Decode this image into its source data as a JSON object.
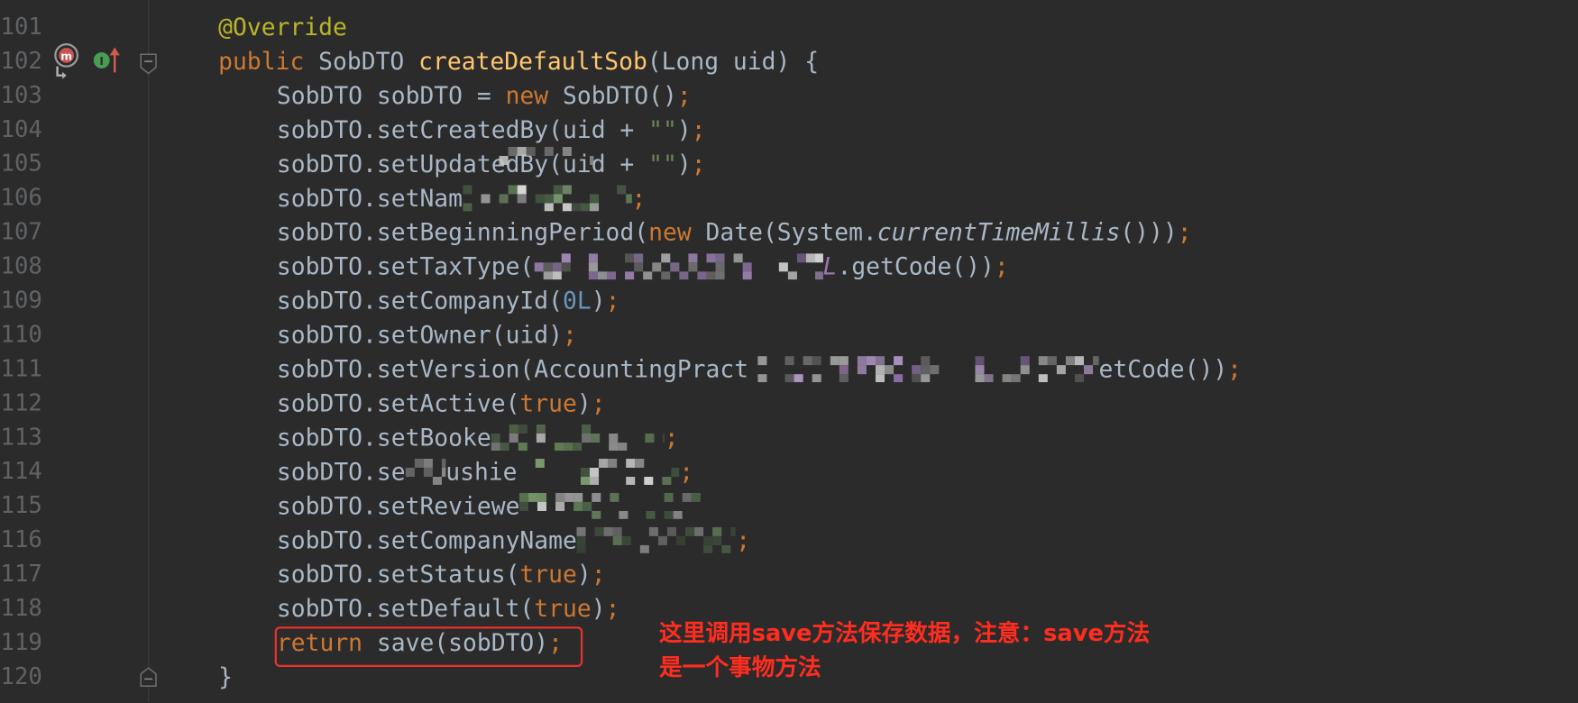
{
  "editor": {
    "theme": "darcula",
    "background": "#2b2b2b",
    "line_number_color": "#606366"
  },
  "syntax_colors": {
    "pl": "#a9b7c6",
    "kw": "#cc7832",
    "ann": "#bbb529",
    "fn": "#ffc66d",
    "str": "#6a8759",
    "num": "#6897bb",
    "it": "#a9b7c6",
    "pu": "#9876aa",
    "semi": "#cc7832"
  },
  "gutter": {
    "line": "102",
    "icons": [
      "overrides-method-icon",
      "implemented-method-icon"
    ],
    "fold_markers": [
      "102",
      "120"
    ]
  },
  "lines": [
    {
      "num": "101",
      "indent": 1,
      "segs": [
        {
          "t": "ann",
          "v": "@Override"
        }
      ]
    },
    {
      "num": "102",
      "indent": 1,
      "segs": [
        {
          "t": "kw",
          "v": "public"
        },
        {
          "t": "pl",
          "v": " SobDTO "
        },
        {
          "t": "fn",
          "v": "createDefaultSob"
        },
        {
          "t": "pl",
          "v": "(Long uid) {"
        }
      ]
    },
    {
      "num": "103",
      "indent": 2,
      "segs": [
        {
          "t": "pl",
          "v": "SobDTO sobDTO = "
        },
        {
          "t": "kw",
          "v": "new"
        },
        {
          "t": "pl",
          "v": " SobDTO()"
        },
        {
          "t": "semi",
          "v": ";"
        }
      ]
    },
    {
      "num": "104",
      "indent": 2,
      "segs": [
        {
          "t": "pl",
          "v": "sobDTO.setCreatedBy(uid + "
        },
        {
          "t": "str",
          "v": "\"\""
        },
        {
          "t": "pl",
          "v": ")"
        },
        {
          "t": "semi",
          "v": ";"
        }
      ]
    },
    {
      "num": "105",
      "indent": 2,
      "segs": [
        {
          "t": "pl",
          "v": "sobDTO.setUpdatedBy(uid + "
        },
        {
          "t": "str",
          "v": "\"\""
        },
        {
          "t": "pl",
          "v": ")"
        },
        {
          "t": "semi",
          "v": ";"
        }
      ]
    },
    {
      "num": "106",
      "indent": 2,
      "segs": [
        {
          "t": "pl",
          "v": "sobDTO.setNam"
        },
        {
          "t": "redacted"
        },
        {
          "t": "semi",
          "v": ";"
        }
      ]
    },
    {
      "num": "107",
      "indent": 2,
      "segs": [
        {
          "t": "pl",
          "v": "sobDTO.setBeginningPeriod("
        },
        {
          "t": "kw",
          "v": "new"
        },
        {
          "t": "pl",
          "v": " Date(System."
        },
        {
          "t": "it",
          "v": "currentTimeMillis"
        },
        {
          "t": "pl",
          "v": "()))"
        },
        {
          "t": "semi",
          "v": ";"
        }
      ]
    },
    {
      "num": "108",
      "indent": 2,
      "segs": [
        {
          "t": "pl",
          "v": "sobDTO.setTaxType("
        },
        {
          "t": "redacted"
        },
        {
          "t": "pu",
          "v": "L"
        },
        {
          "t": "pl",
          "v": ".getCode())"
        },
        {
          "t": "semi",
          "v": ";"
        }
      ]
    },
    {
      "num": "109",
      "indent": 2,
      "segs": [
        {
          "t": "pl",
          "v": "sobDTO.setCompanyId("
        },
        {
          "t": "num",
          "v": "0L"
        },
        {
          "t": "pl",
          "v": ")"
        },
        {
          "t": "semi",
          "v": ";"
        }
      ]
    },
    {
      "num": "110",
      "indent": 2,
      "segs": [
        {
          "t": "pl",
          "v": "sobDTO.setOwner(uid)"
        },
        {
          "t": "semi",
          "v": ";"
        }
      ]
    },
    {
      "num": "111",
      "indent": 2,
      "segs": [
        {
          "t": "pl",
          "v": "sobDTO.setVersion(AccountingPract"
        },
        {
          "t": "redacted"
        },
        {
          "t": "pl",
          "v": "etCode())"
        },
        {
          "t": "semi",
          "v": ";"
        }
      ]
    },
    {
      "num": "112",
      "indent": 2,
      "segs": [
        {
          "t": "pl",
          "v": "sobDTO.setActive("
        },
        {
          "t": "kw",
          "v": "true"
        },
        {
          "t": "pl",
          "v": ")"
        },
        {
          "t": "semi",
          "v": ";"
        }
      ]
    },
    {
      "num": "113",
      "indent": 2,
      "segs": [
        {
          "t": "pl",
          "v": "sobDTO.setBooke"
        },
        {
          "t": "redacted"
        },
        {
          "t": "semi",
          "v": ";"
        }
      ]
    },
    {
      "num": "114",
      "indent": 2,
      "segs": [
        {
          "t": "pl",
          "v": "sobDTO.se"
        },
        {
          "t": "redacted"
        },
        {
          "t": "pl",
          "v": "ushie"
        },
        {
          "t": "redacted"
        },
        {
          "t": "semi",
          "v": ";"
        }
      ]
    },
    {
      "num": "115",
      "indent": 2,
      "segs": [
        {
          "t": "pl",
          "v": "sobDTO.setReviewe"
        },
        {
          "t": "redacted"
        }
      ]
    },
    {
      "num": "116",
      "indent": 2,
      "segs": [
        {
          "t": "pl",
          "v": "sobDTO.setCompanyName"
        },
        {
          "t": "redacted"
        },
        {
          "t": "semi",
          "v": ";"
        }
      ]
    },
    {
      "num": "117",
      "indent": 2,
      "segs": [
        {
          "t": "pl",
          "v": "sobDTO.setStatus("
        },
        {
          "t": "kw",
          "v": "true"
        },
        {
          "t": "pl",
          "v": ")"
        },
        {
          "t": "semi",
          "v": ";"
        }
      ]
    },
    {
      "num": "118",
      "indent": 2,
      "segs": [
        {
          "t": "pl",
          "v": "sobDTO.setDefault("
        },
        {
          "t": "kw",
          "v": "true"
        },
        {
          "t": "pl",
          "v": ")"
        },
        {
          "t": "semi",
          "v": ";"
        }
      ]
    },
    {
      "num": "119",
      "indent": 2,
      "segs": [
        {
          "t": "kw",
          "v": "return"
        },
        {
          "t": "pl",
          "v": " save(sobDTO)"
        },
        {
          "t": "semi",
          "v": ";"
        }
      ]
    },
    {
      "num": "120",
      "indent": 1,
      "segs": [
        {
          "t": "pl",
          "v": "}"
        }
      ]
    }
  ],
  "highlight": {
    "line": "119",
    "color": "#e8322a"
  },
  "annotation": {
    "line1": "这里调用save方法保存数据，注意：save方法",
    "line2": "是一个事物方法",
    "color": "#ff2d1f"
  }
}
